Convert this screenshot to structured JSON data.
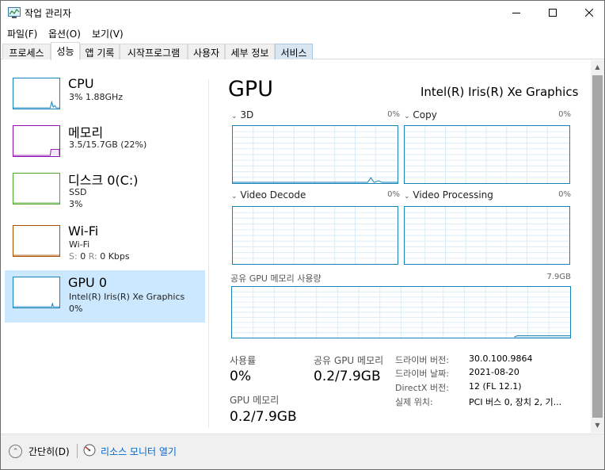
{
  "window": {
    "title": "작업 관리자",
    "app_icon": "task-manager-icon",
    "controls": [
      "minimize-icon",
      "maximize-icon",
      "close-icon"
    ]
  },
  "menu": [
    "파일(F)",
    "옵션(O)",
    "보기(V)"
  ],
  "tabs": [
    {
      "label": "프로세스"
    },
    {
      "label": "성능"
    },
    {
      "label": "앱 기록"
    },
    {
      "label": "시작프로그램"
    },
    {
      "label": "사용자"
    },
    {
      "label": "세부 정보"
    },
    {
      "label": "서비스"
    }
  ],
  "selected_tab": "성능",
  "resources": [
    {
      "name": "CPU",
      "line1": "3% 1.88GHz",
      "line2": "",
      "color": "#1582b8"
    },
    {
      "name": "메모리",
      "line1": "3.5/15.7GB (22%)",
      "line2": "",
      "color": "#8b12ae"
    },
    {
      "name": "디스크 0(C:)",
      "line1": "SSD",
      "line2": "3%",
      "color": "#4da82d"
    },
    {
      "name": "Wi-Fi",
      "line1": "Wi-Fi",
      "line2_prefix_s": "S:",
      "line2_s_val": "0",
      "line2_prefix_r": "R:",
      "line2_r_val": "0 Kbps",
      "color": "#a74f01"
    },
    {
      "name": "GPU 0",
      "line1": "Intel(R) Iris(R) Xe Graphics",
      "line2": "0%",
      "color": "#1582b8"
    }
  ],
  "selected_resource": "GPU 0",
  "detail": {
    "title": "GPU",
    "model": "Intel(R) Iris(R) Xe Graphics",
    "engines": [
      {
        "name": "3D",
        "pct": "0%"
      },
      {
        "name": "Copy",
        "pct": "0%"
      },
      {
        "name": "Video Decode",
        "pct": "0%"
      },
      {
        "name": "Video Processing",
        "pct": "0%"
      }
    ],
    "shared_graph": {
      "label": "공유 GPU 메모리 사용량",
      "max": "7.9GB"
    },
    "stats": {
      "utilization_label": "사용률",
      "utilization_value": "0%",
      "shared_mem_label": "공유 GPU 메모리",
      "shared_mem_value": "0.2/7.9GB",
      "gpu_mem_label": "GPU 메모리",
      "gpu_mem_value": "0.2/7.9GB"
    },
    "info": [
      {
        "label": "드라이버 버전:",
        "value": "30.0.100.9864"
      },
      {
        "label": "드라이버 날짜:",
        "value": "2021-08-20"
      },
      {
        "label": "DirectX 버전:",
        "value": "12 (FL 12.1)"
      },
      {
        "label": "실제 위치:",
        "value": "PCI 버스 0, 장치 2, 기..."
      }
    ]
  },
  "footer": {
    "fewer_details": "간단히(D)",
    "resource_monitor": "리소스 모니터 열기"
  },
  "colors": {
    "gpu_accent": "#1582b8",
    "selected_bg": "#cce8ff",
    "link": "#0066cc"
  }
}
